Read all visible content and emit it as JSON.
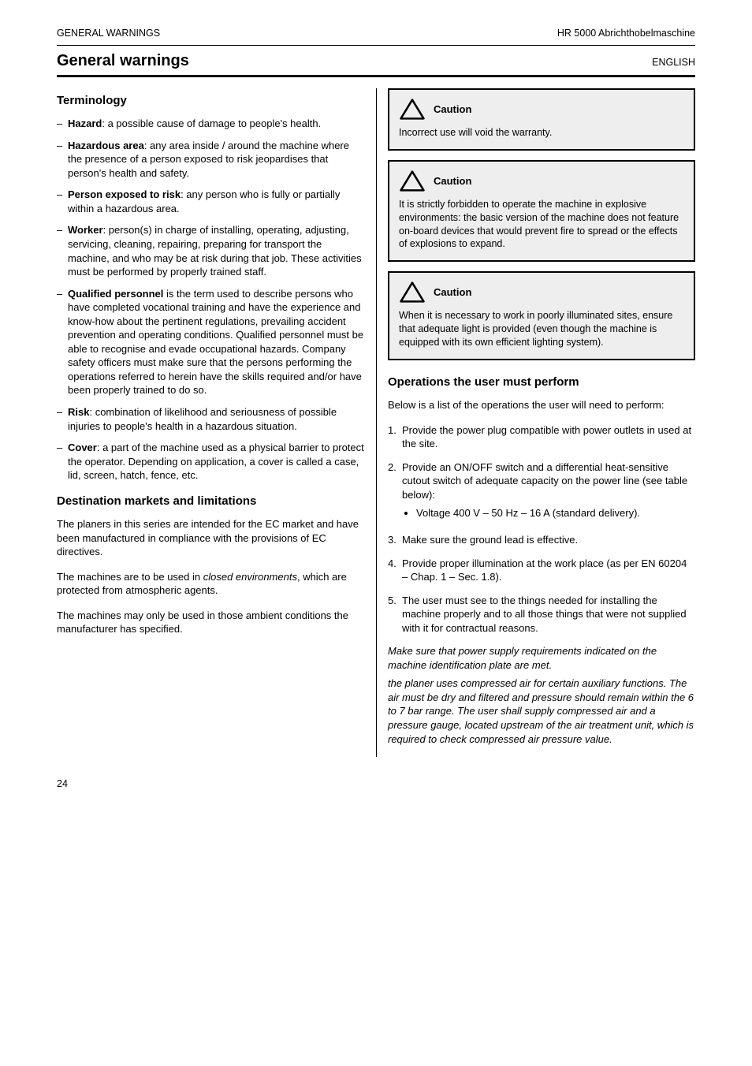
{
  "header": {
    "left": "GENERAL WARNINGS",
    "right": "HR 5000 Abrichthobelmaschine",
    "section_title": "General warnings",
    "lang": "ENGLISH"
  },
  "left": {
    "sub1": "Terminology",
    "terms": [
      {
        "t": "Hazard",
        "d": ": a possible cause of damage to people's health."
      },
      {
        "t": "Hazardous area",
        "d": ": any area inside / around the machine where the presence of a person exposed to risk jeopardises that person's health and safety."
      },
      {
        "t": "Person exposed to risk",
        "d": ": any person who is fully or partially within a hazardous area."
      },
      {
        "t": "Worker",
        "d": ": person(s) in charge of installing, operating, adjusting, servicing, cleaning, repairing, preparing for transport the machine, and who may be at risk during that job. These activities must be performed by properly trained staff."
      },
      {
        "t": "Qualified personnel ",
        "d": "is the term used to describe persons who have completed vocational training and have the experience and know-how about the pertinent regulations, prevailing accident prevention and operating conditions. Qualified personnel must be able to recognise and evade occupational hazards. Company safety officers must make sure that the persons performing the operations referred to herein have the skills required and/or have been properly trained to do so."
      },
      {
        "t": "Risk",
        "d": ": combination of likelihood and seriousness of possible injuries to people's health in a hazardous situation."
      },
      {
        "t": "Cover",
        "d": ": a part of the machine used as a physical barrier to protect the operator. Depending on application, a cover is called a case, lid, screen, hatch, fence, etc."
      }
    ],
    "sub2": "Destination markets and limitations",
    "p1": "The planers in this series are intended for the EC market and have been manufactured in compliance with the provisions of EC directives.",
    "p2_label": "The machines are to be used in ",
    "p2_em": "closed environments",
    "p2_rest": ", which are protected from atmospheric agents.",
    "p3": "The machines may only be used in those ambient conditions the manufacturer has specified."
  },
  "warns": [
    {
      "head": "Caution",
      "body": "Incorrect use will void the warranty."
    },
    {
      "head": "Caution",
      "body": "It is strictly forbidden to operate the machine in explosive environments: the basic version of the machine does not feature on-board devices that would prevent fire to spread or the effects of explosions to expand."
    },
    {
      "head": "Caution",
      "body": "When it is necessary to work in poorly illuminated sites, ensure that adequate light is provided (even though the machine is equipped with its own efficient lighting system)."
    }
  ],
  "right": {
    "sub": "Operations the user must perform",
    "intro": "Below is a list of the operations the user will need to perform:",
    "steps": [
      {
        "n": "1.",
        "t": "Provide the power plug compatible with power outlets in used at the site."
      },
      {
        "n": "2.",
        "t": "Provide an ON/OFF switch and a differential heat-sensitive cutout switch of adequate capacity on the power line (see table below):",
        "sub": [
          "Voltage 400 V – 50 Hz – 16 A (standard delivery)."
        ]
      },
      {
        "n": "3.",
        "t": "Make sure the ground lead is effective."
      },
      {
        "n": "4.",
        "t": "Provide proper illumination at the work place (as per EN 60204 – Chap. 1 – Sec. 1.8)."
      },
      {
        "n": "5.",
        "t": "The user must see to the things needed for installing the machine properly and to all those things that were not supplied with it for contractual reasons."
      }
    ],
    "notes": [
      "Make sure that power supply requirements indicated on the machine identification plate are met.",
      "the planer uses compressed air for certain auxiliary functions. The air must be dry and filtered and pressure should remain within the 6 to 7 bar range. The user shall supply compressed air and a pressure gauge, located upstream of the air treatment unit, which is required to check compressed air pressure value."
    ]
  },
  "page": "24"
}
